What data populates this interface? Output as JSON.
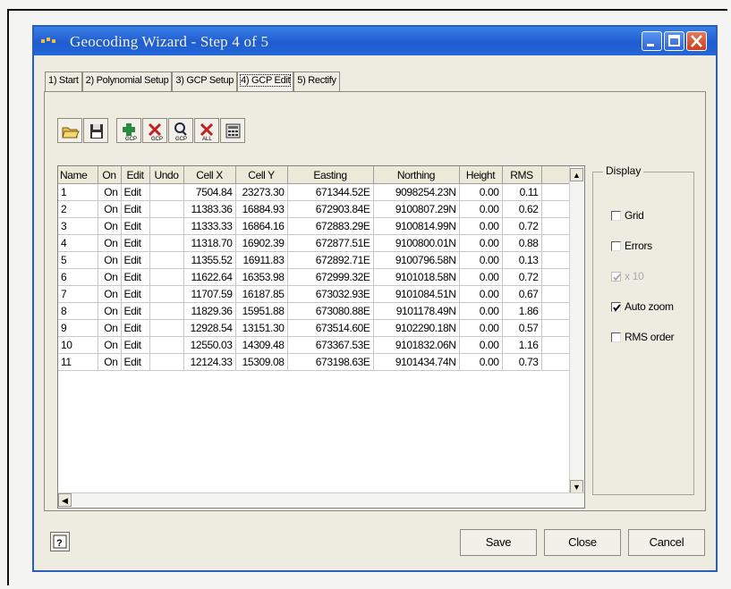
{
  "window": {
    "title": "Geocoding Wizard - Step 4 of 5"
  },
  "tabs": [
    {
      "label": "1) Start"
    },
    {
      "label": "2) Polynomial Setup"
    },
    {
      "label": "3) GCP Setup"
    },
    {
      "label": "4) GCP Edit",
      "active": true
    },
    {
      "label": "5) Rectify"
    }
  ],
  "toolbar_icons": [
    "open-folder-icon",
    "save-disk-icon",
    "add-gcp-icon",
    "delete-gcp-icon",
    "find-gcp-icon",
    "delete-all-icon",
    "calculator-icon"
  ],
  "table": {
    "columns": [
      "Name",
      "On",
      "Edit",
      "Undo",
      "Cell X",
      "Cell Y",
      "Easting",
      "Northing",
      "Height",
      "RMS"
    ],
    "rows": [
      [
        "1",
        "On",
        "Edit",
        "",
        "7504.84",
        "23273.30",
        "671344.52E",
        "9098254.23N",
        "0.00",
        "0.11"
      ],
      [
        "2",
        "On",
        "Edit",
        "",
        "11383.36",
        "16884.93",
        "672903.84E",
        "9100807.29N",
        "0.00",
        "0.62"
      ],
      [
        "3",
        "On",
        "Edit",
        "",
        "11333.33",
        "16864.16",
        "672883.29E",
        "9100814.99N",
        "0.00",
        "0.72"
      ],
      [
        "4",
        "On",
        "Edit",
        "",
        "11318.70",
        "16902.39",
        "672877.51E",
        "9100800.01N",
        "0.00",
        "0.88"
      ],
      [
        "5",
        "On",
        "Edit",
        "",
        "11355.52",
        "16911.83",
        "672892.71E",
        "9100796.58N",
        "0.00",
        "0.13"
      ],
      [
        "6",
        "On",
        "Edit",
        "",
        "11622.64",
        "16353.98",
        "672999.32E",
        "9101018.58N",
        "0.00",
        "0.72"
      ],
      [
        "7",
        "On",
        "Edit",
        "",
        "11707.59",
        "16187.85",
        "673032.93E",
        "9101084.51N",
        "0.00",
        "0.67"
      ],
      [
        "8",
        "On",
        "Edit",
        "",
        "11829.36",
        "15951.88",
        "673080.88E",
        "9101178.49N",
        "0.00",
        "1.86"
      ],
      [
        "9",
        "On",
        "Edit",
        "",
        "12928.54",
        "13151.30",
        "673514.60E",
        "9102290.18N",
        "0.00",
        "0.57"
      ],
      [
        "10",
        "On",
        "Edit",
        "",
        "12550.03",
        "14309.48",
        "673367.53E",
        "9101832.06N",
        "0.00",
        "1.16"
      ],
      [
        "11",
        "On",
        "Edit",
        "",
        "12124.33",
        "15309.08",
        "673198.63E",
        "9101434.74N",
        "0.00",
        "0.73"
      ]
    ]
  },
  "display": {
    "legend": "Display",
    "options": [
      {
        "label": "Grid",
        "checked": false,
        "enabled": true
      },
      {
        "label": "Errors",
        "checked": false,
        "enabled": true
      },
      {
        "label": "x 10",
        "checked": true,
        "enabled": false
      },
      {
        "label": "Auto zoom",
        "checked": true,
        "enabled": true
      },
      {
        "label": "RMS order",
        "checked": false,
        "enabled": true
      }
    ]
  },
  "buttons": {
    "save": "Save",
    "close": "Close",
    "cancel": "Cancel"
  }
}
